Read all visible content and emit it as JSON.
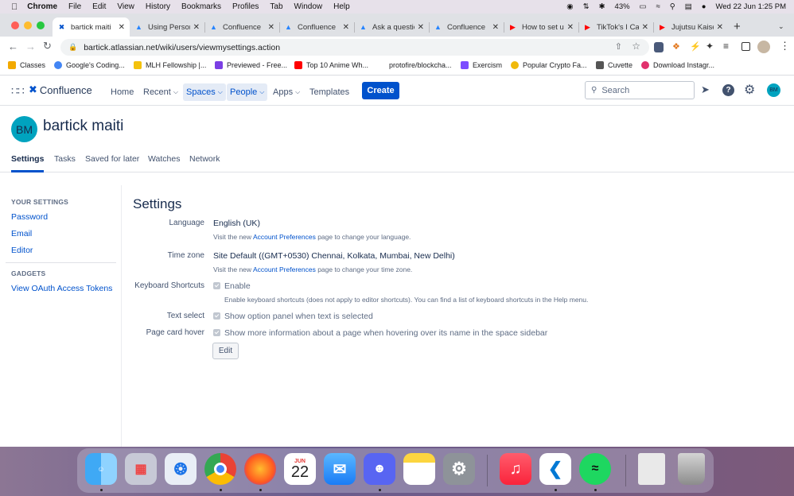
{
  "menubar": {
    "app": "Chrome",
    "items": [
      "File",
      "Edit",
      "View",
      "History",
      "Bookmarks",
      "Profiles",
      "Tab",
      "Window",
      "Help"
    ],
    "battery": "43%",
    "datetime": "Wed 22 Jun  1:25 PM"
  },
  "tabs": [
    {
      "title": "bartick maiti",
      "active": true
    },
    {
      "title": "Using Person"
    },
    {
      "title": "Confluence"
    },
    {
      "title": "Confluence"
    },
    {
      "title": "Ask a questio"
    },
    {
      "title": "Confluence"
    },
    {
      "title": "How to set u"
    },
    {
      "title": "TikTok's I Ca"
    },
    {
      "title": "Jujutsu Kaise"
    }
  ],
  "address": {
    "url": "bartick.atlassian.net/wiki/users/viewmysettings.action"
  },
  "bookmarks": [
    "Classes",
    "Google's Coding...",
    "MLH Fellowship |...",
    "Previewed - Free...",
    "Top 10 Anime Wh...",
    "protofire/blockcha...",
    "Exercism",
    "Popular Crypto Fa...",
    "Cuvette",
    "Download Instagr..."
  ],
  "confluence": {
    "brand": "Confluence",
    "nav": {
      "home": "Home",
      "recent": "Recent",
      "spaces": "Spaces",
      "people": "People",
      "apps": "Apps",
      "templates": "Templates",
      "create": "Create"
    },
    "search_placeholder": "Search",
    "user_initials": "BM",
    "accent": "#0052CC"
  },
  "profile": {
    "initials": "BM",
    "name": "bartick maiti",
    "tabs": [
      "Settings",
      "Tasks",
      "Saved for later",
      "Watches",
      "Network"
    ]
  },
  "sidebar": {
    "your_settings_heading": "YOUR SETTINGS",
    "your_settings": [
      "Password",
      "Email",
      "Editor"
    ],
    "gadgets_heading": "GADGETS",
    "gadgets": [
      "View OAuth Access Tokens"
    ]
  },
  "settings": {
    "title": "Settings",
    "language_label": "Language",
    "language_value": "English (UK)",
    "language_hint_pre": "Visit the new ",
    "link_text": "Account Preferences",
    "language_hint_post": " page to change your language.",
    "timezone_label": "Time zone",
    "timezone_value": "Site Default ((GMT+0530) Chennai, Kolkata, Mumbai, New Delhi)",
    "timezone_hint_post": " page to change your time zone.",
    "shortcuts_label": "Keyboard Shortcuts",
    "shortcuts_value": "Enable",
    "shortcuts_hint": "Enable keyboard shortcuts (does not apply to editor shortcuts). You can find a list of keyboard shortcuts in the Help menu.",
    "textselect_label": "Text select",
    "textselect_value": "Show option panel when text is selected",
    "pagecard_label": "Page card hover",
    "pagecard_value": "Show more information about a page when hovering over its name in the space sidebar",
    "edit_button": "Edit"
  },
  "dock": {
    "calendar_month": "JUN",
    "calendar_day": "22",
    "apps": [
      "finder-icon",
      "launchpad-icon",
      "safari-icon",
      "chrome-icon",
      "firefox-icon",
      "calendar-icon",
      "mail-icon",
      "discord-icon",
      "notes-icon",
      "system-preferences-icon",
      "music-icon",
      "vscode-icon",
      "spotify-icon",
      "preview-icon",
      "trash-icon"
    ]
  }
}
